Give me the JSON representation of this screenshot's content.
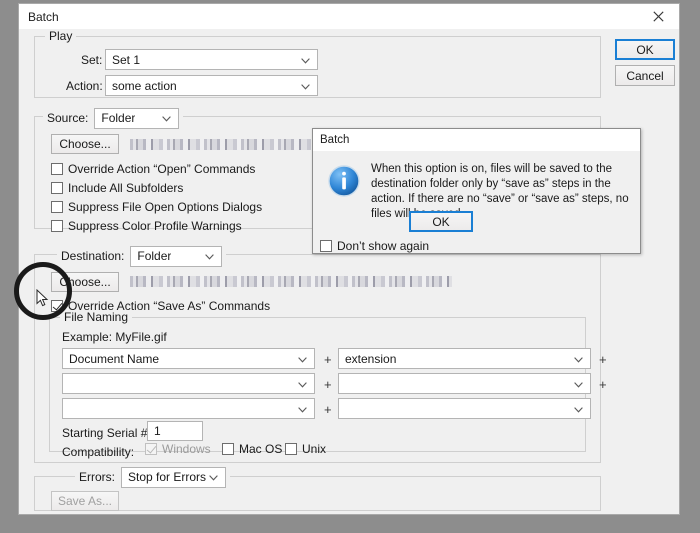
{
  "window": {
    "title": "Batch",
    "close_icon": "close-icon"
  },
  "buttons": {
    "ok": "OK",
    "cancel": "Cancel"
  },
  "play": {
    "legend": "Play",
    "set_label": "Set:",
    "set_value": "Set 1",
    "action_label": "Action:",
    "action_value": "some action"
  },
  "source": {
    "legend": "Source:",
    "value": "Folder",
    "choose_label": "Choose...",
    "path_redacted": "",
    "options": [
      {
        "label": "Override Action “Open” Commands",
        "checked": false
      },
      {
        "label": "Include All Subfolders",
        "checked": false
      },
      {
        "label": "Suppress File Open Options Dialogs",
        "checked": false
      },
      {
        "label": "Suppress Color Profile Warnings",
        "checked": false
      }
    ]
  },
  "destination": {
    "legend": "Destination:",
    "value": "Folder",
    "choose_label": "Choose...",
    "path_redacted": "",
    "override_label": "Override Action “Save As” Commands",
    "override_checked": true
  },
  "file_naming": {
    "legend": "File Naming",
    "example_label": "Example: MyFile.gif",
    "fields": [
      {
        "left": "Document Name",
        "right": "extension"
      },
      {
        "left": "",
        "right": ""
      },
      {
        "left": "",
        "right": ""
      }
    ],
    "plus": "+",
    "serial_label": "Starting Serial #:",
    "serial_value": "1",
    "compat_label": "Compatibility:",
    "compat": [
      {
        "label": "Windows",
        "checked": true,
        "disabled": true
      },
      {
        "label": "Mac OS",
        "checked": false,
        "disabled": false
      },
      {
        "label": "Unix",
        "checked": false,
        "disabled": false
      }
    ]
  },
  "errors": {
    "legend": "Errors:",
    "value": "Stop for Errors",
    "save_as_label": "Save As..."
  },
  "alert": {
    "title": "Batch",
    "icon": "info-icon",
    "message": "When this option is on, files will be saved to the destination folder only by “save as” steps in the action. If there are no “save” or “save as” steps, no files will be saved.",
    "ok_label": "OK",
    "dont_show_label": "Don’t show again",
    "dont_show_checked": false
  },
  "colors": {
    "desktop": "#8d8d8d",
    "dialog_bg": "#f0f0f0",
    "accent": "#1a7fd4",
    "info_blue": "#1f76c8"
  }
}
